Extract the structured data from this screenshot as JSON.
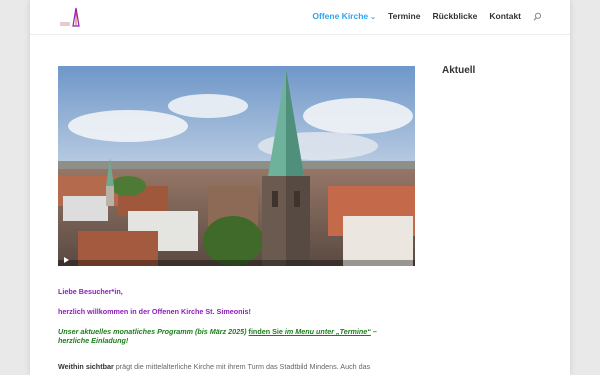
{
  "nav": {
    "items": [
      {
        "label": "Offene Kirche",
        "active": true,
        "has_dropdown": true
      },
      {
        "label": "Termine",
        "active": false
      },
      {
        "label": "Rückblicke",
        "active": false
      },
      {
        "label": "Kontakt",
        "active": false
      }
    ],
    "search_icon": "search-icon"
  },
  "logo": {
    "icon": "church-logo-icon"
  },
  "sidebar": {
    "title": "Aktuell"
  },
  "content": {
    "greeting": "Liebe Besucher*in,",
    "welcome": "herzlich willkommen in der Offenen Kirche St. Simeonis!",
    "programm_pre": "Unser aktuelles monatliches Programm (bis März 2025) ",
    "programm_mid": "finden Sie ",
    "programm_link": "im Menu unter „Termine“",
    "programm_post": " –",
    "programm_line2": "herzliche Einladung!",
    "intro_bold": "Weithin sichtbar",
    "intro_text": " prägt die mittelalterliche Kirche mit ihrem Turm das Stadtbild Mindens. Auch das"
  },
  "colors": {
    "accent": "#2ea3f2",
    "purple": "#8b1fb8",
    "green": "#1b7f1b"
  }
}
